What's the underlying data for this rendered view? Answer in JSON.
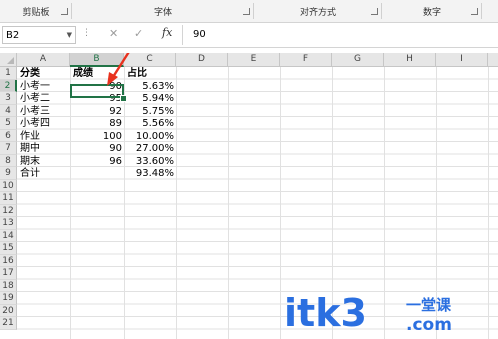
{
  "ribbon": {
    "groups": [
      {
        "label": "剪贴板"
      },
      {
        "label": "字体"
      },
      {
        "label": "对齐方式"
      },
      {
        "label": "数字"
      }
    ]
  },
  "formula_bar": {
    "name_box": "B2",
    "cancel_symbol": "✕",
    "enter_symbol": "✓",
    "fx_symbol": "fx",
    "value": "90"
  },
  "sheet": {
    "columns": [
      "A",
      "B",
      "C",
      "D",
      "E",
      "F",
      "G",
      "H",
      "I"
    ],
    "rows": [
      "1",
      "2",
      "3",
      "4",
      "5",
      "6",
      "7",
      "8",
      "9",
      "10",
      "11",
      "12",
      "13",
      "14",
      "15",
      "16",
      "17",
      "18",
      "19",
      "20",
      "21"
    ],
    "header": {
      "a": "分类",
      "b": "成绩",
      "c": "占比"
    },
    "data": [
      {
        "a": "小考一",
        "b": "90",
        "c": "5.63%"
      },
      {
        "a": "小考二",
        "b": "95",
        "c": "5.94%"
      },
      {
        "a": "小考三",
        "b": "92",
        "c": "5.75%"
      },
      {
        "a": "小考四",
        "b": "89",
        "c": "5.56%"
      },
      {
        "a": "作业",
        "b": "100",
        "c": "10.00%"
      },
      {
        "a": "期中",
        "b": "90",
        "c": "27.00%"
      },
      {
        "a": "期末",
        "b": "96",
        "c": "33.60%"
      },
      {
        "a": "合计",
        "b": "",
        "c": "93.48%"
      }
    ],
    "selected_cell": "B2",
    "selection_color": "#217346"
  },
  "annotation": {
    "arrow_color": "#e8321e"
  },
  "watermark": {
    "text": "itk3",
    "suffix": "一堂课",
    "domain": ".com",
    "color": "#2b6fe0"
  }
}
